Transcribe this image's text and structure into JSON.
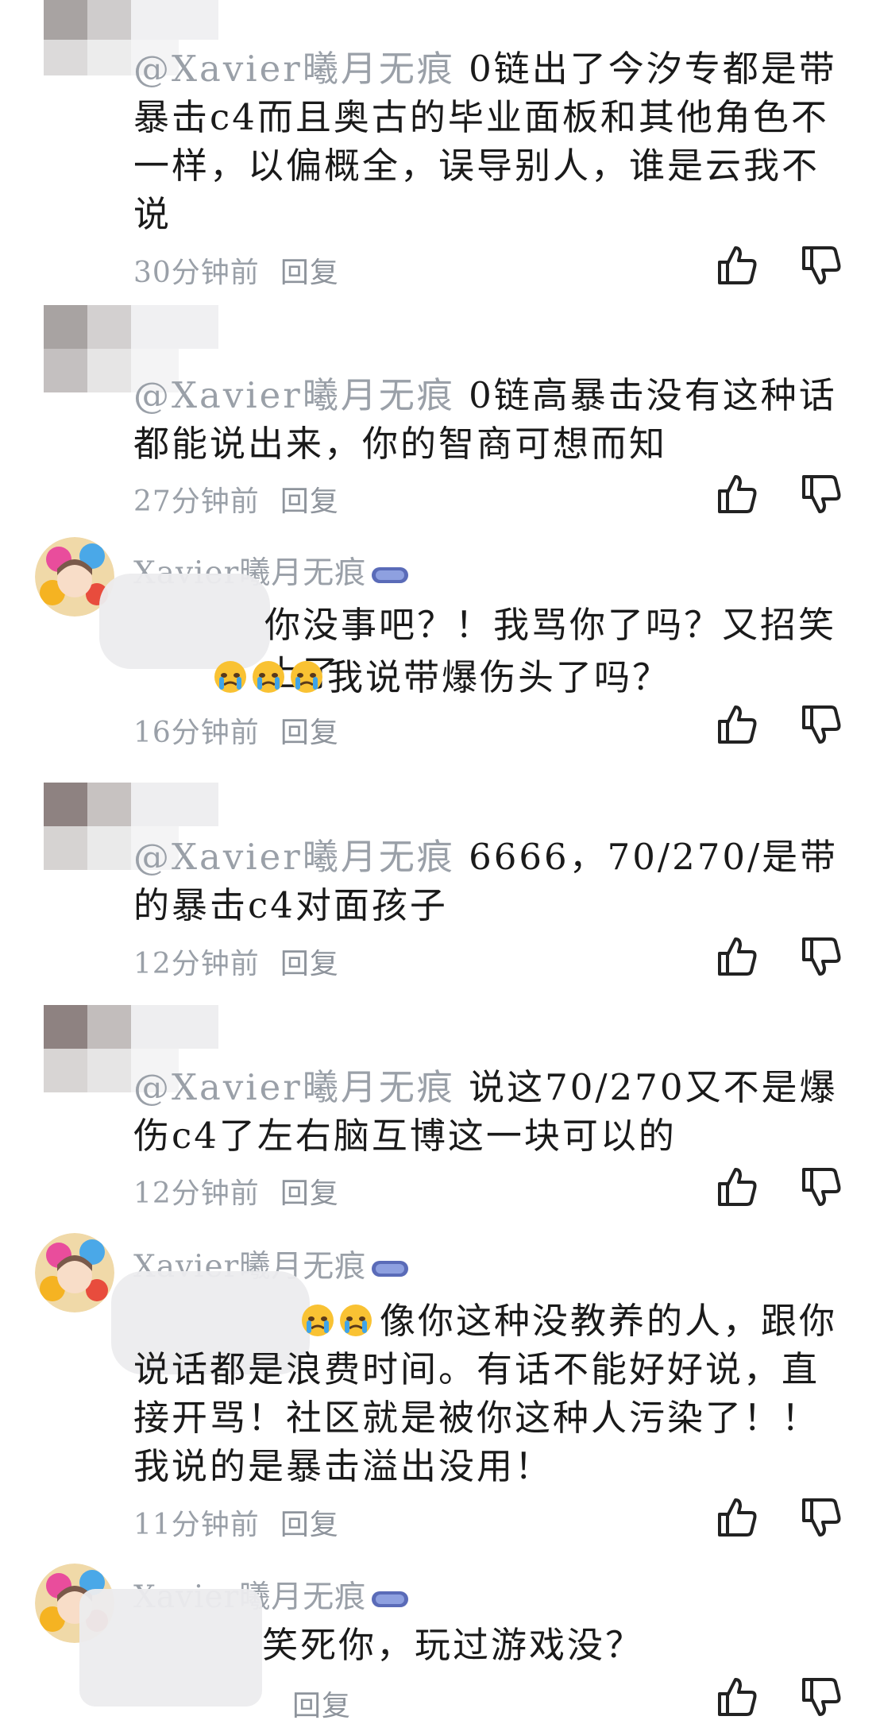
{
  "comments": [
    {
      "mention": "@Xavier曦月无痕",
      "text": " 0链出了今汐专都是带暴击c4而且奥古的毕业面板和其他角色不一样，以偏概全，误导别人，谁是云我不说",
      "time": "30分钟前",
      "reply": "回复"
    },
    {
      "mention": "@Xavier曦月无痕",
      "text": " 0链高暴击没有这种话都能说出来，你的智商可想而知",
      "time": "27分钟前",
      "reply": "回复"
    },
    {
      "username": "Xavier曦月无痕",
      "text": "你没事吧？！我骂你了吗？又招笑上了",
      "text_after": "我说带爆伤头了吗？",
      "time": "16分钟前",
      "reply": "回复"
    },
    {
      "mention": "@Xavier曦月无痕",
      "text": " 6666，70/270/是带的暴击c4对面孩子",
      "time": "12分钟前",
      "reply": "回复"
    },
    {
      "mention": "@Xavier曦月无痕",
      "text": " 说这70/270又不是爆伤c4了左右脑互博这一块可以的",
      "time": "12分钟前",
      "reply": "回复"
    },
    {
      "username": "Xavier曦月无痕",
      "text": "像你这种没教养的人，跟你说话都是浪费时间。有话不能好好说，直接开骂！社区就是被你这种人污染了！！我说的是暴击溢出没用！",
      "time": "11分钟前",
      "reply": "回复"
    },
    {
      "username": "Xavier曦月无痕",
      "text": "笑死你，玩过游戏没？",
      "time": "",
      "reply": "回复"
    }
  ],
  "icons": {
    "like": "thumbs-up-icon",
    "dislike": "thumbs-down-icon",
    "emoji": "crying-face-emoji",
    "badge": "game-festival-badge"
  },
  "colors": {
    "meta": "#9aa0a8",
    "text": "#1a1a1a"
  }
}
